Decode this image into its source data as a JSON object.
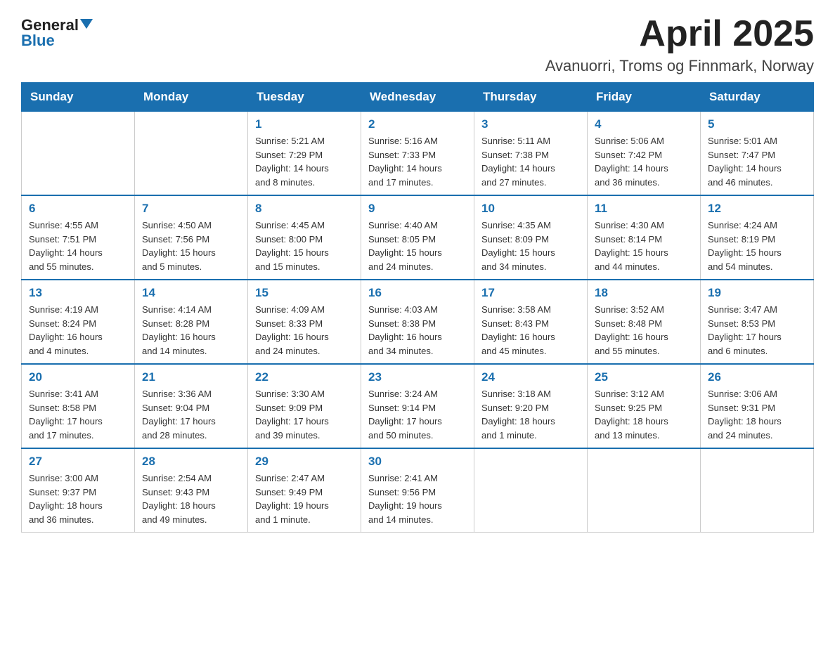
{
  "logo": {
    "general": "General",
    "blue": "Blue"
  },
  "title": {
    "month_year": "April 2025",
    "location": "Avanuorri, Troms og Finnmark, Norway"
  },
  "headers": [
    "Sunday",
    "Monday",
    "Tuesday",
    "Wednesday",
    "Thursday",
    "Friday",
    "Saturday"
  ],
  "weeks": [
    [
      {
        "day": "",
        "info": ""
      },
      {
        "day": "",
        "info": ""
      },
      {
        "day": "1",
        "info": "Sunrise: 5:21 AM\nSunset: 7:29 PM\nDaylight: 14 hours\nand 8 minutes."
      },
      {
        "day": "2",
        "info": "Sunrise: 5:16 AM\nSunset: 7:33 PM\nDaylight: 14 hours\nand 17 minutes."
      },
      {
        "day": "3",
        "info": "Sunrise: 5:11 AM\nSunset: 7:38 PM\nDaylight: 14 hours\nand 27 minutes."
      },
      {
        "day": "4",
        "info": "Sunrise: 5:06 AM\nSunset: 7:42 PM\nDaylight: 14 hours\nand 36 minutes."
      },
      {
        "day": "5",
        "info": "Sunrise: 5:01 AM\nSunset: 7:47 PM\nDaylight: 14 hours\nand 46 minutes."
      }
    ],
    [
      {
        "day": "6",
        "info": "Sunrise: 4:55 AM\nSunset: 7:51 PM\nDaylight: 14 hours\nand 55 minutes."
      },
      {
        "day": "7",
        "info": "Sunrise: 4:50 AM\nSunset: 7:56 PM\nDaylight: 15 hours\nand 5 minutes."
      },
      {
        "day": "8",
        "info": "Sunrise: 4:45 AM\nSunset: 8:00 PM\nDaylight: 15 hours\nand 15 minutes."
      },
      {
        "day": "9",
        "info": "Sunrise: 4:40 AM\nSunset: 8:05 PM\nDaylight: 15 hours\nand 24 minutes."
      },
      {
        "day": "10",
        "info": "Sunrise: 4:35 AM\nSunset: 8:09 PM\nDaylight: 15 hours\nand 34 minutes."
      },
      {
        "day": "11",
        "info": "Sunrise: 4:30 AM\nSunset: 8:14 PM\nDaylight: 15 hours\nand 44 minutes."
      },
      {
        "day": "12",
        "info": "Sunrise: 4:24 AM\nSunset: 8:19 PM\nDaylight: 15 hours\nand 54 minutes."
      }
    ],
    [
      {
        "day": "13",
        "info": "Sunrise: 4:19 AM\nSunset: 8:24 PM\nDaylight: 16 hours\nand 4 minutes."
      },
      {
        "day": "14",
        "info": "Sunrise: 4:14 AM\nSunset: 8:28 PM\nDaylight: 16 hours\nand 14 minutes."
      },
      {
        "day": "15",
        "info": "Sunrise: 4:09 AM\nSunset: 8:33 PM\nDaylight: 16 hours\nand 24 minutes."
      },
      {
        "day": "16",
        "info": "Sunrise: 4:03 AM\nSunset: 8:38 PM\nDaylight: 16 hours\nand 34 minutes."
      },
      {
        "day": "17",
        "info": "Sunrise: 3:58 AM\nSunset: 8:43 PM\nDaylight: 16 hours\nand 45 minutes."
      },
      {
        "day": "18",
        "info": "Sunrise: 3:52 AM\nSunset: 8:48 PM\nDaylight: 16 hours\nand 55 minutes."
      },
      {
        "day": "19",
        "info": "Sunrise: 3:47 AM\nSunset: 8:53 PM\nDaylight: 17 hours\nand 6 minutes."
      }
    ],
    [
      {
        "day": "20",
        "info": "Sunrise: 3:41 AM\nSunset: 8:58 PM\nDaylight: 17 hours\nand 17 minutes."
      },
      {
        "day": "21",
        "info": "Sunrise: 3:36 AM\nSunset: 9:04 PM\nDaylight: 17 hours\nand 28 minutes."
      },
      {
        "day": "22",
        "info": "Sunrise: 3:30 AM\nSunset: 9:09 PM\nDaylight: 17 hours\nand 39 minutes."
      },
      {
        "day": "23",
        "info": "Sunrise: 3:24 AM\nSunset: 9:14 PM\nDaylight: 17 hours\nand 50 minutes."
      },
      {
        "day": "24",
        "info": "Sunrise: 3:18 AM\nSunset: 9:20 PM\nDaylight: 18 hours\nand 1 minute."
      },
      {
        "day": "25",
        "info": "Sunrise: 3:12 AM\nSunset: 9:25 PM\nDaylight: 18 hours\nand 13 minutes."
      },
      {
        "day": "26",
        "info": "Sunrise: 3:06 AM\nSunset: 9:31 PM\nDaylight: 18 hours\nand 24 minutes."
      }
    ],
    [
      {
        "day": "27",
        "info": "Sunrise: 3:00 AM\nSunset: 9:37 PM\nDaylight: 18 hours\nand 36 minutes."
      },
      {
        "day": "28",
        "info": "Sunrise: 2:54 AM\nSunset: 9:43 PM\nDaylight: 18 hours\nand 49 minutes."
      },
      {
        "day": "29",
        "info": "Sunrise: 2:47 AM\nSunset: 9:49 PM\nDaylight: 19 hours\nand 1 minute."
      },
      {
        "day": "30",
        "info": "Sunrise: 2:41 AM\nSunset: 9:56 PM\nDaylight: 19 hours\nand 14 minutes."
      },
      {
        "day": "",
        "info": ""
      },
      {
        "day": "",
        "info": ""
      },
      {
        "day": "",
        "info": ""
      }
    ]
  ]
}
